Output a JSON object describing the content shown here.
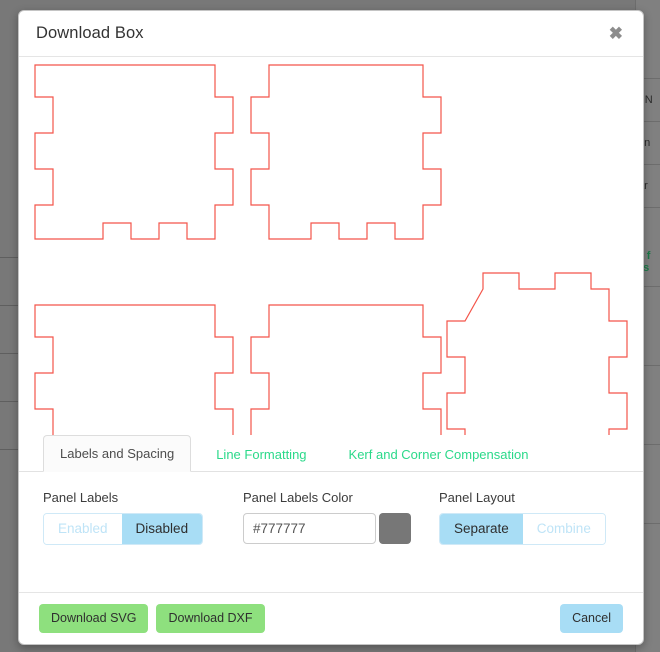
{
  "modal": {
    "title": "Download Box",
    "close_icon": "close-icon",
    "close_glyph": "✖"
  },
  "preview": {
    "stroke_color": "#f4554a",
    "description": "Box panel cut layout with finger joints",
    "panels": [
      {
        "name": "panel-top-left",
        "type": "side-panel"
      },
      {
        "name": "panel-top-center",
        "type": "side-panel-tabbed"
      },
      {
        "name": "panel-bottom-left",
        "type": "side-panel"
      },
      {
        "name": "panel-bottom-center",
        "type": "side-panel-tabbed"
      },
      {
        "name": "panel-bottom-right",
        "type": "base-panel-all-tabs"
      }
    ]
  },
  "tabs": [
    {
      "label": "Labels and Spacing",
      "active": true
    },
    {
      "label": "Line Formatting",
      "active": false
    },
    {
      "label": "Kerf and Corner Compensation",
      "active": false
    }
  ],
  "controls": {
    "panel_labels": {
      "label": "Panel Labels",
      "options": [
        "Enabled",
        "Disabled"
      ],
      "selected": "Disabled"
    },
    "panel_labels_color": {
      "label": "Panel Labels Color",
      "value": "#777777",
      "placeholder": "#777777",
      "swatch_color": "#777777"
    },
    "panel_layout": {
      "label": "Panel Layout",
      "options": [
        "Separate",
        "Combine"
      ],
      "selected": "Separate"
    }
  },
  "footer": {
    "download_svg": "Download SVG",
    "download_dxf": "Download DXF",
    "cancel": "Cancel"
  },
  "background": {
    "right_cells": [
      "r N",
      "en",
      "ar"
    ],
    "green_text_line1": "g f",
    "green_text_line2": "as",
    "glyph": "◖"
  },
  "colors": {
    "accent_green": "#2bd98a",
    "button_green": "#8ee07e",
    "accent_blue": "#a8ddf5",
    "stroke_red": "#f4554a"
  }
}
